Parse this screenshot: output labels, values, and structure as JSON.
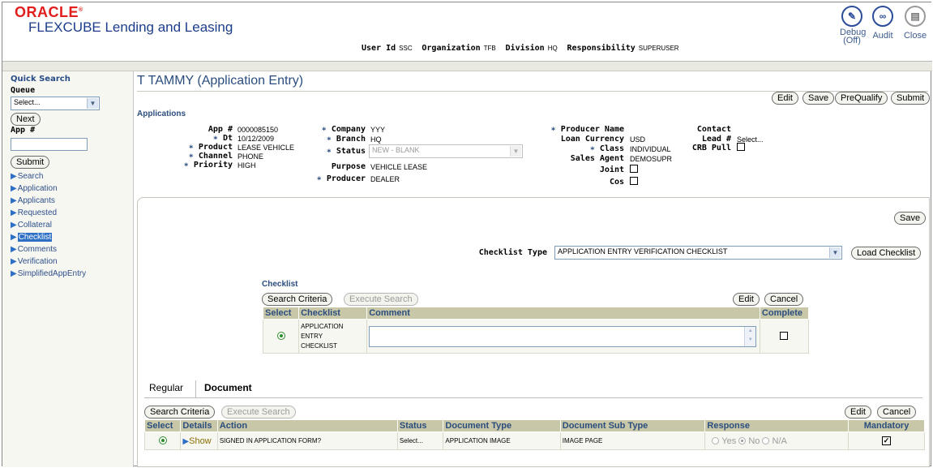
{
  "header": {
    "brand": "ORACLE",
    "product": "FLEXCUBE Lending and Leasing",
    "user_bar": [
      {
        "label": "User Id",
        "value": "SSC"
      },
      {
        "label": "Organization",
        "value": "TFB"
      },
      {
        "label": "Division",
        "value": "HQ"
      },
      {
        "label": "Responsibility",
        "value": "SUPERUSER"
      }
    ],
    "actions": {
      "debug": "Debug",
      "debug_state": "(Off)",
      "audit": "Audit",
      "close": "Close"
    }
  },
  "sidebar": {
    "title": "Quick Search",
    "queue_label": "Queue",
    "queue_value": "Select...",
    "next_button": "Next",
    "app_label": "App #",
    "submit_button": "Submit",
    "items": [
      "Search",
      "Application",
      "Applicants",
      "Requested",
      "Collateral",
      "Checklist",
      "Comments",
      "Verification",
      "SimplifiedAppEntry"
    ],
    "active_item": "Checklist"
  },
  "page": {
    "title": "T TAMMY (Application Entry)",
    "buttons": {
      "edit": "Edit",
      "save": "Save",
      "prequalify": "PreQualify",
      "submit": "Submit"
    },
    "section_title": "Applications"
  },
  "application": {
    "app_no_label": "App #",
    "app_no": "0000085150",
    "dt_label": "Dt",
    "dt": "10/12/2009",
    "product_label": "Product",
    "product": "LEASE VEHICLE",
    "channel_label": "Channel",
    "channel": "PHONE",
    "priority_label": "Priority",
    "priority": "HIGH",
    "company_label": "Company",
    "company": "YYY",
    "branch_label": "Branch",
    "branch": "HQ",
    "status_label": "Status",
    "status": "NEW - BLANK",
    "purpose_label": "Purpose",
    "purpose": "VEHICLE LEASE",
    "producer_label": "Producer",
    "producer": "DEALER",
    "producer_name_label": "Producer Name",
    "loan_currency_label": "Loan Currency",
    "loan_currency": "USD",
    "class_label": "Class",
    "class": "INDIVIDUAL",
    "sales_agent_label": "Sales Agent",
    "sales_agent": "DEMOSUPR",
    "joint_label": "Joint",
    "cos_label": "Cos",
    "contact_label": "Contact",
    "lead_label": "Lead #",
    "lead": "Select...",
    "crb_pull_label": "CRB Pull"
  },
  "checklist_panel": {
    "save_button": "Save",
    "checklist_type_label": "Checklist Type",
    "checklist_type_value": "APPLICATION ENTRY VERIFICATION CHECKLIST",
    "load_button": "Load Checklist",
    "section_title": "Checklist",
    "search_criteria": "Search Criteria",
    "execute_search": "Execute Search",
    "edit": "Edit",
    "cancel": "Cancel",
    "columns": [
      "Select",
      "Checklist",
      "Comment",
      "Complete"
    ],
    "rows": [
      {
        "checklist_lines": [
          "APPLICATION",
          "ENTRY",
          "CHECKLIST"
        ],
        "comment": "",
        "complete": false
      }
    ]
  },
  "document_panel": {
    "tabs": [
      "Regular",
      "Document"
    ],
    "active_tab": "Document",
    "search_criteria": "Search Criteria",
    "execute_search": "Execute Search",
    "edit": "Edit",
    "cancel": "Cancel",
    "columns": [
      "Select",
      "Details",
      "Action",
      "Status",
      "Document Type",
      "Document Sub Type",
      "Response",
      "Mandatory"
    ],
    "rows": [
      {
        "details": "Show",
        "action": "SIGNED IN APPLICATION FORM?",
        "status": "Select...",
        "document_type": "APPLICATION IMAGE",
        "document_sub_type": "IMAGE PAGE",
        "response_options": [
          "Yes",
          "No",
          "N/A"
        ],
        "response": "No",
        "mandatory": true
      }
    ]
  }
}
